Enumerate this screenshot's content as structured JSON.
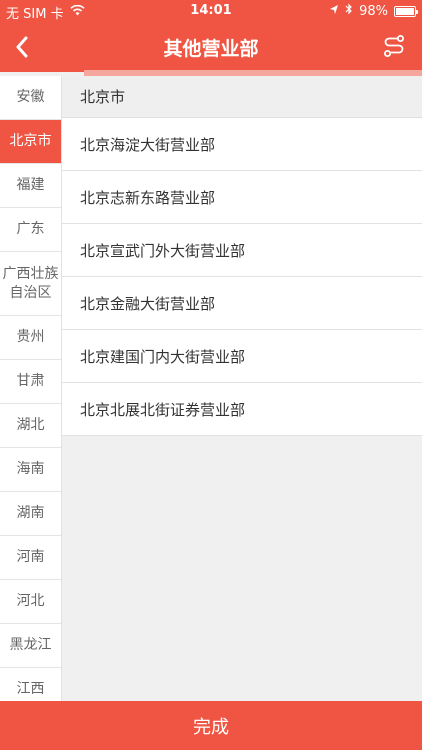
{
  "status_bar": {
    "carrier": "无 SIM 卡",
    "time": "14:01",
    "battery": "98%"
  },
  "header": {
    "title": "其他营业部"
  },
  "sidebar": {
    "items": [
      {
        "label": "安徽"
      },
      {
        "label": "北京市"
      },
      {
        "label": "福建"
      },
      {
        "label": "广东"
      },
      {
        "label": "广西壮族自治区"
      },
      {
        "label": "贵州"
      },
      {
        "label": "甘肃"
      },
      {
        "label": "湖北"
      },
      {
        "label": "海南"
      },
      {
        "label": "湖南"
      },
      {
        "label": "河南"
      },
      {
        "label": "河北"
      },
      {
        "label": "黑龙江"
      },
      {
        "label": "江西"
      }
    ],
    "selected": "北京市"
  },
  "content": {
    "section_title": "北京市",
    "branches": [
      {
        "name": "北京海淀大街营业部"
      },
      {
        "name": "北京志新东路营业部"
      },
      {
        "name": "北京宣武门外大街营业部"
      },
      {
        "name": "北京金融大街营业部"
      },
      {
        "name": "北京建国门内大街营业部"
      },
      {
        "name": "北京北展北街证券营业部"
      }
    ]
  },
  "footer": {
    "done_label": "完成"
  },
  "colors": {
    "accent": "#ef5542",
    "tab_indicator": "#f6a79d"
  }
}
